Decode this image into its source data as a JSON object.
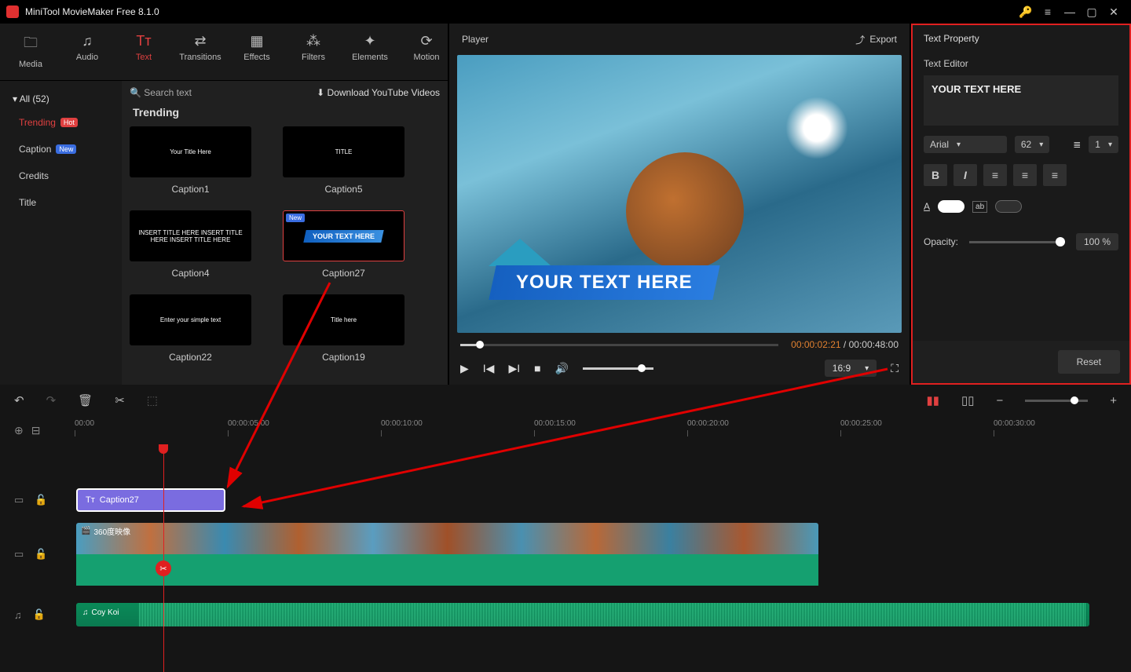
{
  "app": {
    "title": "MiniTool MovieMaker Free 8.1.0"
  },
  "tabs": [
    {
      "label": "Media",
      "icon": "🗀"
    },
    {
      "label": "Audio",
      "icon": "♫"
    },
    {
      "label": "Text",
      "icon": "Tт",
      "active": true
    },
    {
      "label": "Transitions",
      "icon": "⇄"
    },
    {
      "label": "Effects",
      "icon": "▦"
    },
    {
      "label": "Filters",
      "icon": "⁂"
    },
    {
      "label": "Elements",
      "icon": "✦"
    },
    {
      "label": "Motion",
      "icon": "⟳"
    }
  ],
  "sidebar": {
    "all": "All (52)",
    "items": [
      {
        "label": "Trending",
        "badge": "Hot",
        "badgeClass": "hot",
        "active": true
      },
      {
        "label": "Caption",
        "badge": "New",
        "badgeClass": "new"
      },
      {
        "label": "Credits"
      },
      {
        "label": "Title"
      }
    ]
  },
  "gallery": {
    "search_placeholder": "Search text",
    "download_label": "Download YouTube Videos",
    "heading": "Trending",
    "cards": [
      {
        "label": "Caption1",
        "thumbText": "Your Title Here"
      },
      {
        "label": "Caption5",
        "thumbText": "TITLE"
      },
      {
        "label": "Caption4",
        "thumbText": "INSERT TITLE HERE INSERT TITLE HERE INSERT TITLE HERE"
      },
      {
        "label": "Caption27",
        "thumbText": "YOUR TEXT HERE",
        "selected": true,
        "newBadge": "New"
      },
      {
        "label": "Caption22",
        "thumbText": "Enter your simple text"
      },
      {
        "label": "Caption19",
        "thumbText": "Title here"
      }
    ]
  },
  "player": {
    "label": "Player",
    "export": "Export",
    "lower_third": "YOUR TEXT HERE",
    "current_time": "00:00:02:21",
    "total_time": "00:00:48:00",
    "aspect": "16:9"
  },
  "panel": {
    "title": "Text Property",
    "editor_label": "Text Editor",
    "text_value": "YOUR TEXT HERE",
    "font": "Arial",
    "size": "62",
    "line": "1",
    "opacity_label": "Opacity:",
    "opacity_value": "100 %",
    "reset": "Reset"
  },
  "timeline": {
    "ticks": [
      "00:00",
      "00:00:05:00",
      "00:00:10:00",
      "00:00:15:00",
      "00:00:20:00",
      "00:00:25:00",
      "00:00:30:00"
    ],
    "text_clip": "Caption27",
    "video_clip": "360度映像",
    "audio_clip": "Coy Koi"
  }
}
